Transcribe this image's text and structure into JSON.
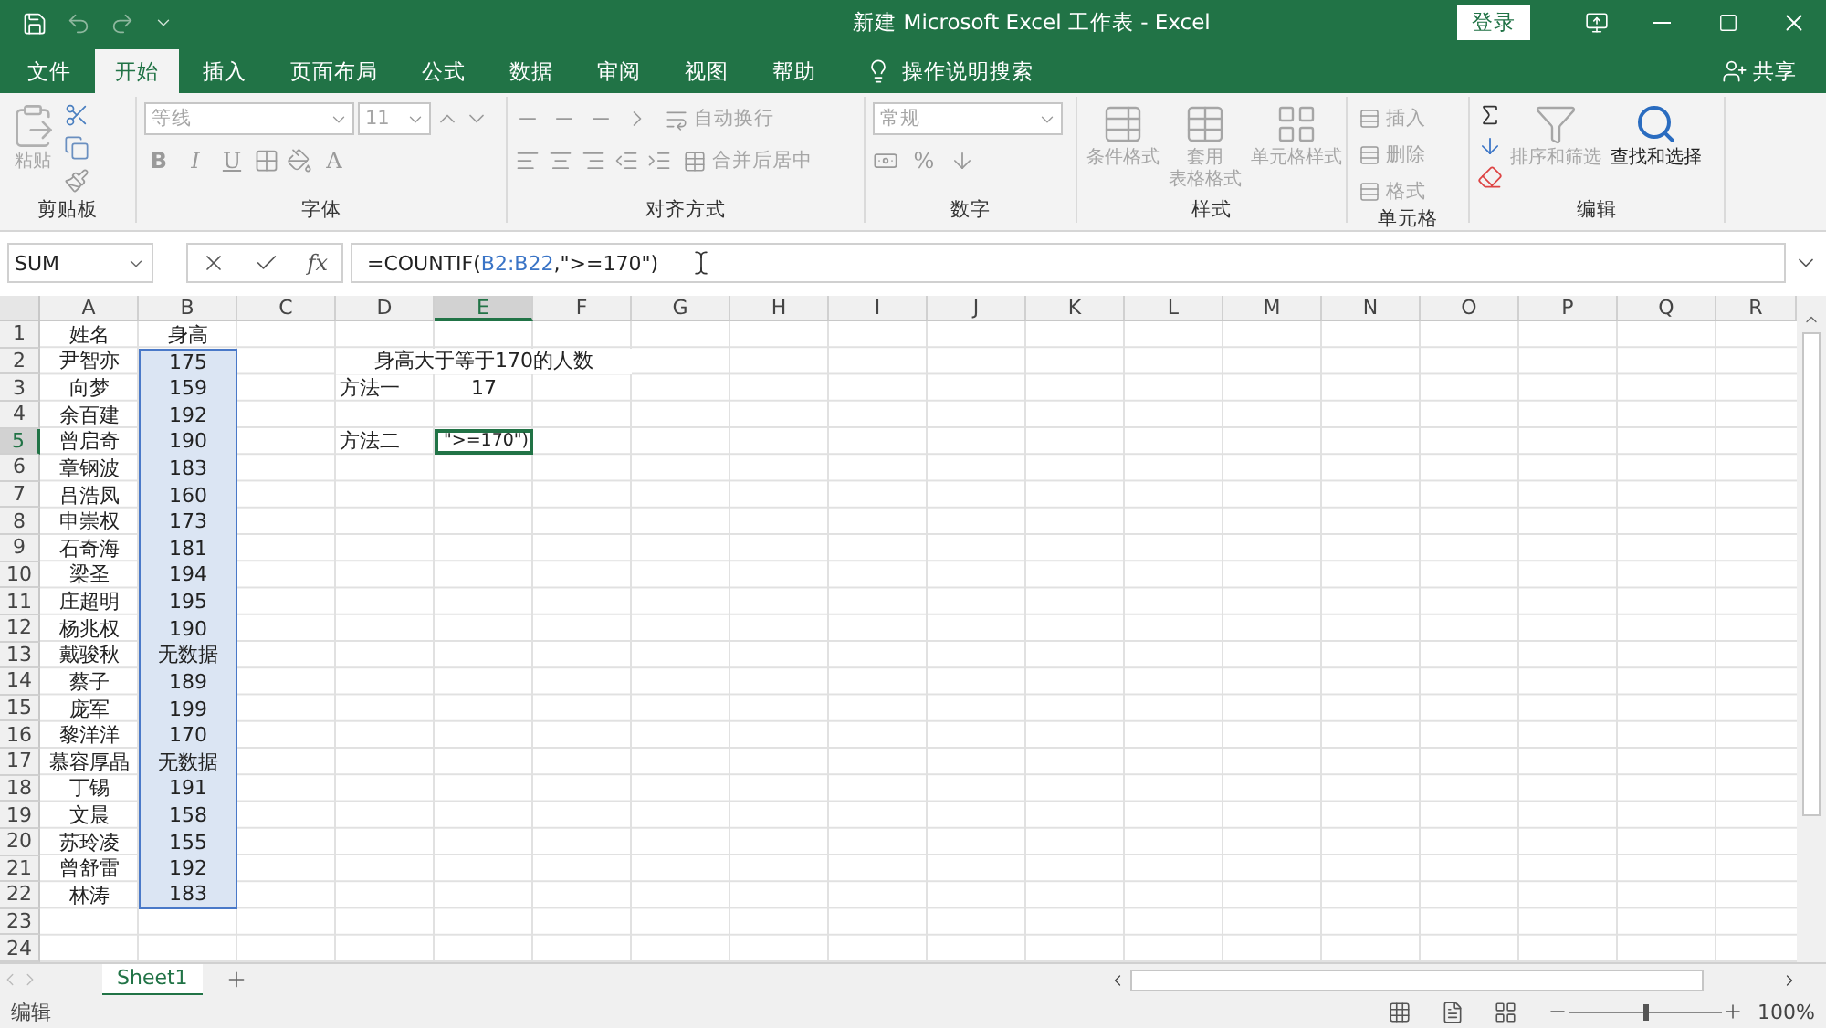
{
  "title_bar": {
    "title": "新建 Microsoft Excel 工作表  -  Excel",
    "login": "登录"
  },
  "menu_tabs": [
    {
      "label": "文件",
      "selected": false
    },
    {
      "label": "开始",
      "selected": true
    },
    {
      "label": "插入",
      "selected": false
    },
    {
      "label": "页面布局",
      "selected": false
    },
    {
      "label": "公式",
      "selected": false
    },
    {
      "label": "数据",
      "selected": false
    },
    {
      "label": "审阅",
      "selected": false
    },
    {
      "label": "视图",
      "selected": false
    },
    {
      "label": "帮助",
      "selected": false
    }
  ],
  "tell_me": "操作说明搜索",
  "share": "共享",
  "ribbon": {
    "clipboard": {
      "paste": {
        "label": "粘贴",
        "disabled": true
      },
      "group": "剪贴板"
    },
    "font": {
      "name": {
        "value": "等线",
        "disabled": true
      },
      "size": {
        "value": "11",
        "disabled": true
      },
      "bold": "B",
      "italic": "I",
      "underline": "U",
      "font_color": "A",
      "group": "字体"
    },
    "alignment": {
      "wrap": {
        "label": "自动换行",
        "disabled": true
      },
      "merge": {
        "label": "合并后居中",
        "disabled": true
      },
      "group": "对齐方式"
    },
    "number": {
      "format": {
        "value": "常规",
        "disabled": true
      },
      "percent": "%",
      "group": "数字"
    },
    "styles": {
      "items": [
        {
          "lines": [
            "条件格式"
          ],
          "disabled": true
        },
        {
          "lines": [
            "套用",
            "表格格式"
          ],
          "disabled": true
        },
        {
          "lines": [
            "单元格样式"
          ],
          "disabled": true
        }
      ],
      "group": "样式"
    },
    "cells": {
      "items": [
        {
          "label": "插入",
          "disabled": true
        },
        {
          "label": "删除",
          "disabled": true
        },
        {
          "label": "格式",
          "disabled": true
        }
      ],
      "group": "单元格"
    },
    "editing": {
      "sort": {
        "label": "排序和筛选",
        "disabled": true
      },
      "find": {
        "label": "查找和选择",
        "disabled": false
      },
      "group": "编辑"
    }
  },
  "formula_bar": {
    "name_box": "SUM",
    "function_label": "fx",
    "formula": [
      {
        "text": "=COUNTIF(",
        "kind": "plain"
      },
      {
        "text": "B2:B22",
        "kind": "reference"
      },
      {
        "text": ",\">=170\")",
        "kind": "plain"
      }
    ]
  },
  "grid": {
    "columns": [
      {
        "label": "A",
        "selected": false
      },
      {
        "label": "B",
        "selected": false
      },
      {
        "label": "C",
        "selected": false
      },
      {
        "label": "D",
        "selected": false
      },
      {
        "label": "E",
        "selected": true
      },
      {
        "label": "F",
        "selected": false
      },
      {
        "label": "G",
        "selected": false
      },
      {
        "label": "H",
        "selected": false
      },
      {
        "label": "I",
        "selected": false
      },
      {
        "label": "J",
        "selected": false
      },
      {
        "label": "K",
        "selected": false
      },
      {
        "label": "L",
        "selected": false
      },
      {
        "label": "M",
        "selected": false
      },
      {
        "label": "N",
        "selected": false
      },
      {
        "label": "O",
        "selected": false
      },
      {
        "label": "P",
        "selected": false
      },
      {
        "label": "Q",
        "selected": false
      },
      {
        "label": "R",
        "selected": false
      }
    ],
    "rows": [
      {
        "number": "1",
        "selected": false,
        "name": {
          "text": "姓名"
        },
        "height": {
          "text": "身高",
          "selected": false
        }
      },
      {
        "number": "2",
        "selected": false,
        "name": {
          "text": "尹智亦"
        },
        "height": {
          "text": "175",
          "selected": true
        },
        "heading": {
          "text": "身高大于等于170的人数"
        }
      },
      {
        "number": "3",
        "selected": false,
        "name": {
          "text": "向梦"
        },
        "height": {
          "text": "159",
          "selected": true
        },
        "label": {
          "text": "方法一"
        },
        "value": {
          "text": "17",
          "active": false
        }
      },
      {
        "number": "4",
        "selected": false,
        "name": {
          "text": "余百建"
        },
        "height": {
          "text": "192",
          "selected": true
        }
      },
      {
        "number": "5",
        "selected": true,
        "name": {
          "text": "曾启奇"
        },
        "height": {
          "text": "190",
          "selected": true
        },
        "label": {
          "text": "方法二"
        },
        "value": {
          "text": "\">=170\")",
          "active": true
        }
      },
      {
        "number": "6",
        "selected": false,
        "name": {
          "text": "章钢波"
        },
        "height": {
          "text": "183",
          "selected": true
        }
      },
      {
        "number": "7",
        "selected": false,
        "name": {
          "text": "吕浩凤"
        },
        "height": {
          "text": "160",
          "selected": true
        }
      },
      {
        "number": "8",
        "selected": false,
        "name": {
          "text": "申崇权"
        },
        "height": {
          "text": "173",
          "selected": true
        }
      },
      {
        "number": "9",
        "selected": false,
        "name": {
          "text": "石奇海"
        },
        "height": {
          "text": "181",
          "selected": true
        }
      },
      {
        "number": "10",
        "selected": false,
        "name": {
          "text": "梁圣"
        },
        "height": {
          "text": "194",
          "selected": true
        }
      },
      {
        "number": "11",
        "selected": false,
        "name": {
          "text": "庄超明"
        },
        "height": {
          "text": "195",
          "selected": true
        }
      },
      {
        "number": "12",
        "selected": false,
        "name": {
          "text": "杨兆权"
        },
        "height": {
          "text": "190",
          "selected": true
        }
      },
      {
        "number": "13",
        "selected": false,
        "name": {
          "text": "戴骏秋"
        },
        "height": {
          "text": "无数据",
          "selected": true
        }
      },
      {
        "number": "14",
        "selected": false,
        "name": {
          "text": "蔡子"
        },
        "height": {
          "text": "189",
          "selected": true
        }
      },
      {
        "number": "15",
        "selected": false,
        "name": {
          "text": "庞军"
        },
        "height": {
          "text": "199",
          "selected": true
        }
      },
      {
        "number": "16",
        "selected": false,
        "name": {
          "text": "黎洋洋"
        },
        "height": {
          "text": "170",
          "selected": true
        }
      },
      {
        "number": "17",
        "selected": false,
        "name": {
          "text": "慕容厚晶"
        },
        "height": {
          "text": "无数据",
          "selected": true
        }
      },
      {
        "number": "18",
        "selected": false,
        "name": {
          "text": "丁锡"
        },
        "height": {
          "text": "191",
          "selected": true
        }
      },
      {
        "number": "19",
        "selected": false,
        "name": {
          "text": "文晨"
        },
        "height": {
          "text": "158",
          "selected": true
        }
      },
      {
        "number": "20",
        "selected": false,
        "name": {
          "text": "苏玲凌"
        },
        "height": {
          "text": "155",
          "selected": true
        }
      },
      {
        "number": "21",
        "selected": false,
        "name": {
          "text": "曾舒雷"
        },
        "height": {
          "text": "192",
          "selected": true
        }
      },
      {
        "number": "22",
        "selected": false,
        "name": {
          "text": "林涛"
        },
        "height": {
          "text": "183",
          "selected": true
        }
      },
      {
        "number": "23",
        "selected": false
      },
      {
        "number": "24",
        "selected": false
      }
    ]
  },
  "sheet_tabs": [
    {
      "label": "Sheet1",
      "selected": true
    }
  ],
  "status_bar": {
    "mode": "编辑",
    "zoom": "100%",
    "zoom_slider": {
      "level": 0.5
    }
  }
}
